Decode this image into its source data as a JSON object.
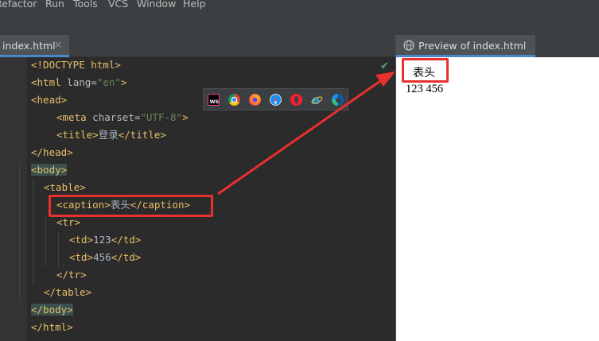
{
  "menu": [
    "Refactor",
    "Run",
    "Tools",
    "VCS",
    "Window",
    "Help"
  ],
  "editor_tab": {
    "label": "index.html",
    "close": "×"
  },
  "preview_tab": {
    "label": "Preview of index.html"
  },
  "code": {
    "l1": "<!DOCTYPE html>",
    "l2_open": "<html",
    "l2_attr": " lang=",
    "l2_val": "\"en\"",
    "l2_close": ">",
    "l3": "<head>",
    "l4_open": "<meta",
    "l4_attr": " charset=",
    "l4_val": "\"UTF-8\"",
    "l4_close": ">",
    "l5_open": "<title>",
    "l5_text": "登录",
    "l5_close": "</title>",
    "l6": "</head>",
    "l7": "<body>",
    "l8": "<table>",
    "l9_open": "<caption>",
    "l9_text": "表头",
    "l9_close": "</caption>",
    "l10": "<tr>",
    "l11_open": "<td>",
    "l11_text": "123",
    "l11_close": "</td>",
    "l12_open": "<td>",
    "l12_text": "456",
    "l12_close": "</td>",
    "l13": "</tr>",
    "l14": "</table>",
    "l15": "</body>",
    "l16": "</html>"
  },
  "preview": {
    "caption": "表头",
    "cells": "123 456"
  },
  "browser_icons": [
    "webstorm-icon",
    "chrome-icon",
    "firefox-icon",
    "safari-icon",
    "opera-icon",
    "ie-icon",
    "edge-icon"
  ],
  "colors": {
    "tag": "#e8bf6a",
    "value": "#6a8759",
    "text": "#a9b7c6",
    "annotation": "#e8302e"
  }
}
